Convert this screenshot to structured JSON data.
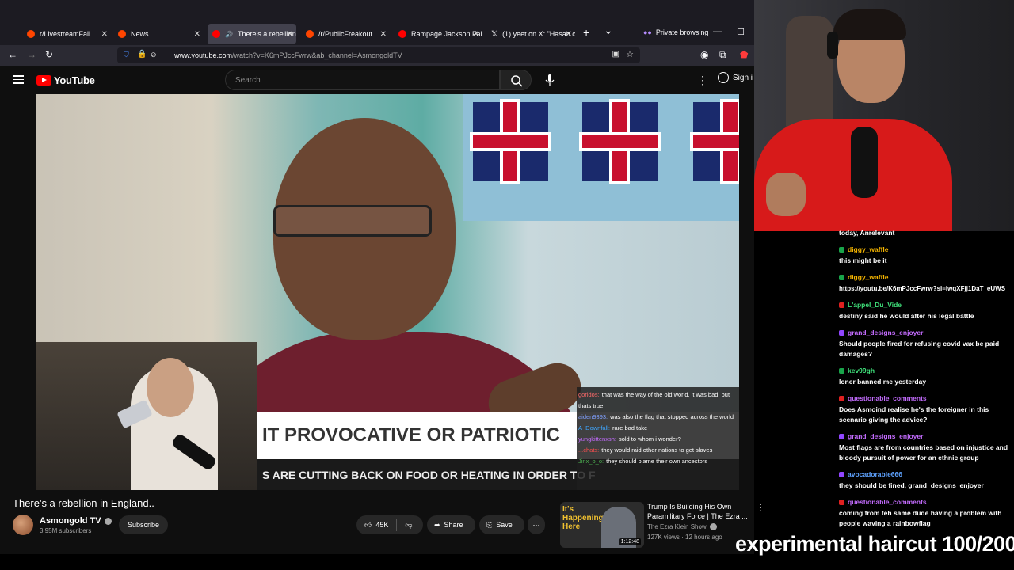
{
  "browser": {
    "tabs": [
      {
        "label": "r/LivestreamFail",
        "color": "#ff4500"
      },
      {
        "label": "News",
        "color": "#ff4500"
      },
      {
        "label": "There's a rebellion",
        "color": "#ff0000"
      },
      {
        "label": "/r/PublicFreakout",
        "color": "#ff4500"
      },
      {
        "label": "Rampage Jackson Faile",
        "color": "#ff0000"
      },
      {
        "label": "(1) yeet on X: \"Hasan c",
        "color": "#ffffff"
      }
    ],
    "new_tab_icon": "+",
    "tab_list_icon": "⌄",
    "private_label": "Private browsing",
    "url_host": "www.youtube.com",
    "url_rest": "/watch?v=K6mPJccFwrw&ab_channel=AsmongoldTV"
  },
  "youtube": {
    "logo_text": "YouTube",
    "search_placeholder": "Search",
    "signin_label": "Sign i"
  },
  "video": {
    "lower_third_title": "IT PROVOCATIVE OR PATRIOTIC",
    "lower_third_subtitle": "S ARE CUTTING BACK ON FOOD OR HEATING IN ORDER TO F",
    "chat": [
      {
        "user": "goridos:",
        "color": "#ff6a6a",
        "text": "that was the way of the old world, it was bad, but thats true"
      },
      {
        "user": "aiden9393:",
        "color": "#7fa0ff",
        "text": "was also the flag that stopped across the world"
      },
      {
        "user": "A_Downfall:",
        "color": "#3ea6ff",
        "text": "rare bad take"
      },
      {
        "user": "yungkittenxsh:",
        "color": "#c46cff",
        "text": "sold to whom i wonder?"
      },
      {
        "user": "...chats:",
        "color": "#ff4f4f",
        "text": "they would raid other nations to get slaves"
      },
      {
        "user": "Jinx_o_o:",
        "color": "#4caf50",
        "text": "they should blame their own ancestors"
      }
    ],
    "title": "There's a rebellion in England..",
    "channel": "Asmongold TV",
    "subscribers": "3.95M subscribers",
    "subscribe_label": "Subscribe",
    "likes": "45K",
    "share_label": "Share",
    "save_label": "Save"
  },
  "recommended": {
    "thumb_text": "It's Happening Here",
    "duration": "1:12:48",
    "title": "Trump Is Building His Own Paramilitary Force | The Ezra ...",
    "channel": "The Ezra Klein Show",
    "meta": "127K views · 12 hours ago"
  },
  "stream_chat": [
    {
      "user": "",
      "color": "",
      "badge": "",
      "text": "today, Anrelevant"
    },
    {
      "user": "diggy_waffle",
      "color": "#f4b400",
      "badge": "#19a44a",
      "text": "this might be it"
    },
    {
      "user": "diggy_waffle",
      "color": "#f4b400",
      "badge": "#19a44a",
      "text": "https://youtu.be/K6mPJccFwrw?si=IwqXFjj1DaT_eUWS"
    },
    {
      "user": "L'appel_Du_Vide",
      "color": "#3fe07a",
      "badge": "#e02020",
      "text": "destiny said he would after his legal battle"
    },
    {
      "user": "grand_designs_enjoyer",
      "color": "#c46cff",
      "badge": "#9146ff",
      "text": "Should people fired for refusing covid vax be paid damages?"
    },
    {
      "user": "kev99gh",
      "color": "#3fe07a",
      "badge": "#19a44a",
      "text": "loner banned me yesterday"
    },
    {
      "user": "questionable_comments",
      "color": "#c46cff",
      "badge": "#e02020",
      "text": "Does Asmoind realise he's the foreigner in this scenario giving the advice?"
    },
    {
      "user": "grand_designs_enjoyer",
      "color": "#c46cff",
      "badge": "#9146ff",
      "text": "Most flags are from countries based on injustice and bloody pursuit of power for an ethnic group"
    },
    {
      "user": "avocadorable666",
      "color": "#5ea2ff",
      "badge": "#9146ff",
      "text": "they should be fined, grand_designs_enjoyer"
    },
    {
      "user": "questionable_comments",
      "color": "#c46cff",
      "badge": "#e02020",
      "text": "coming from teh same dude having a problem with people waving a rainbowflag"
    }
  ],
  "caption": "experimental haircut 100/200"
}
